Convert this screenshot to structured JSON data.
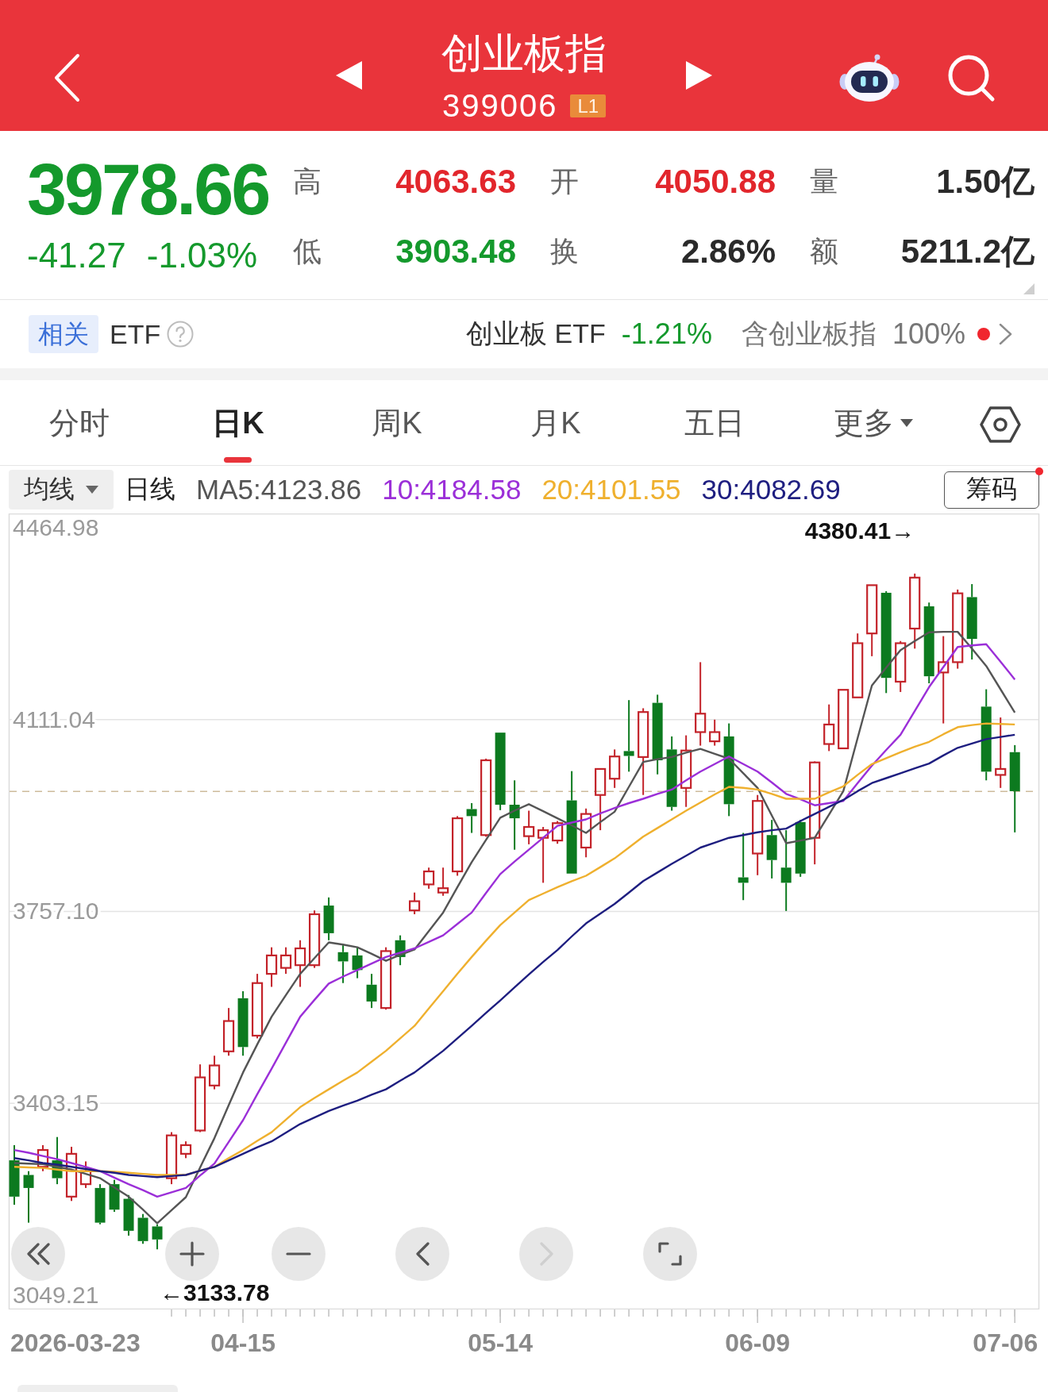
{
  "header": {
    "title": "创业板指",
    "code": "399006",
    "badge": "L1"
  },
  "quote": {
    "price": "3978.66",
    "change": "-41.27",
    "change_percent": "-1.03%",
    "falling": true
  },
  "stats": [
    {
      "label": "高",
      "value": "4063.63",
      "color": "#e2262c"
    },
    {
      "label": "开",
      "value": "4050.88",
      "color": "#e2262c"
    },
    {
      "label": "量",
      "value": "1.50亿",
      "color": "#2a2a2a"
    },
    {
      "label": "低",
      "value": "3903.48",
      "color": "#14992c"
    },
    {
      "label": "换",
      "value": "2.86%",
      "color": "#2a2a2a"
    },
    {
      "label": "额",
      "value": "5211.2亿",
      "color": "#2a2a2a"
    }
  ],
  "related": {
    "tag": "相关",
    "label": "ETF",
    "etf_name": "创业板 ETF",
    "etf_change": "-1.21%",
    "etf_falling": true,
    "holding_label": "含创业板指",
    "holding_percent": "100%",
    "alert": true
  },
  "tabs": [
    {
      "label": "分时",
      "kind": "tab",
      "selected": false
    },
    {
      "label": "日K",
      "kind": "tab",
      "selected": true
    },
    {
      "label": "周K",
      "kind": "tab",
      "selected": false
    },
    {
      "label": "月K",
      "kind": "tab",
      "selected": false
    },
    {
      "label": "五日",
      "kind": "tab",
      "selected": false
    },
    {
      "label": "更多",
      "kind": "menu",
      "selected": false
    }
  ],
  "indicator_bar": {
    "dropdown": "均线",
    "period": "日线",
    "ma": [
      {
        "label": "MA5:4123.86",
        "color": "#555555"
      },
      {
        "label": "10:4184.58",
        "color": "#9b2fd8"
      },
      {
        "label": "20:4101.55",
        "color": "#efb02e"
      },
      {
        "label": "30:4082.69",
        "color": "#1e1e80"
      }
    ],
    "chips_button": "筹码",
    "chips_alert": true
  },
  "chart": {
    "chart_data": {
      "type": "candlestick",
      "categories": [
        null,
        null,
        null,
        null,
        null,
        null,
        null,
        null,
        null,
        null,
        null,
        null,
        null,
        null,
        null,
        null,
        "04-15",
        null,
        null,
        null,
        null,
        null,
        null,
        null,
        null,
        null,
        null,
        null,
        null,
        null,
        null,
        null,
        null,
        null,
        "05-14",
        null,
        null,
        null,
        null,
        null,
        null,
        null,
        null,
        null,
        null,
        null,
        null,
        null,
        null,
        null,
        null,
        null,
        "06-09",
        null,
        null,
        null,
        null,
        null,
        null,
        null,
        null,
        null,
        null,
        null,
        null,
        null,
        null,
        null,
        null,
        null,
        null
      ],
      "ohlc": [
        [
          3298,
          3326,
          3216,
          3231
        ],
        [
          3271,
          3278,
          3183,
          3247
        ],
        [
          3286,
          3326,
          3278,
          3317
        ],
        [
          3298,
          3341,
          3254,
          3265
        ],
        [
          3231,
          3323,
          3223,
          3310
        ],
        [
          3254,
          3296,
          3247,
          3278
        ],
        [
          3247,
          3254,
          3180,
          3183
        ],
        [
          3254,
          3262,
          3203,
          3207
        ],
        [
          3227,
          3234,
          3159,
          3168
        ],
        [
          3192,
          3199,
          3144,
          3149
        ],
        [
          3176,
          3180,
          3133.78,
          3152
        ],
        [
          3265,
          3350,
          3254,
          3344
        ],
        [
          3310,
          3333,
          3302,
          3326
        ],
        [
          3353,
          3475,
          3350,
          3451
        ],
        [
          3436,
          3491,
          3429,
          3473
        ],
        [
          3499,
          3579,
          3491,
          3555
        ],
        [
          3597,
          3610,
          3491,
          3507
        ],
        [
          3528,
          3642,
          3523,
          3625
        ],
        [
          3642,
          3691,
          3618,
          3676
        ],
        [
          3653,
          3691,
          3642,
          3676
        ],
        [
          3658,
          3704,
          3618,
          3689
        ],
        [
          3658,
          3759,
          3653,
          3752
        ],
        [
          3768,
          3783,
          3704,
          3717
        ],
        [
          3682,
          3697,
          3625,
          3665
        ],
        [
          3676,
          3691,
          3634,
          3649
        ],
        [
          3622,
          3642,
          3579,
          3591
        ],
        [
          3579,
          3691,
          3576,
          3684
        ],
        [
          3704,
          3713,
          3658,
          3673
        ],
        [
          3759,
          3792,
          3752,
          3776
        ],
        [
          3807,
          3838,
          3799,
          3831
        ],
        [
          3792,
          3838,
          3786,
          3800
        ],
        [
          3831,
          3933,
          3823,
          3929
        ],
        [
          3946,
          3957,
          3902,
          3933
        ],
        [
          3898,
          4039,
          3895,
          4036
        ],
        [
          4087,
          4087,
          3944,
          3954
        ],
        [
          3954,
          3999,
          3871,
          3929
        ],
        [
          3896,
          3943,
          3881,
          3913
        ],
        [
          3893,
          3913,
          3810,
          3907
        ],
        [
          3888,
          3924,
          3882,
          3920
        ],
        [
          3962,
          4016,
          3827,
          3827
        ],
        [
          3875,
          3947,
          3857,
          3937
        ],
        [
          3972,
          4020,
          3907,
          4020
        ],
        [
          4002,
          4056,
          3985,
          4043
        ],
        [
          4053,
          4147,
          4015,
          4044
        ],
        [
          4042,
          4132,
          3972,
          4125
        ],
        [
          4142,
          4157,
          4010,
          4036
        ],
        [
          4056,
          4080,
          3943,
          3950
        ],
        [
          3985,
          4082,
          3950,
          4054
        ],
        [
          4088,
          4217,
          4063,
          4122
        ],
        [
          4071,
          4111,
          4063,
          4088
        ],
        [
          4080,
          4104,
          3933,
          3955
        ],
        [
          3820,
          3902,
          3778,
          3810
        ],
        [
          3864,
          3972,
          3824,
          3961
        ],
        [
          3898,
          3926,
          3818,
          3852
        ],
        [
          3838,
          3907,
          3758,
          3810
        ],
        [
          3922,
          3926,
          3821,
          3827
        ],
        [
          3893,
          4034,
          3844,
          4032
        ],
        [
          4066,
          4139,
          4053,
          4102
        ],
        [
          4058,
          4166,
          4058,
          4166
        ],
        [
          4152,
          4270,
          4152,
          4252
        ],
        [
          4270,
          4359,
          4228,
          4359
        ],
        [
          4345,
          4348,
          4160,
          4188
        ],
        [
          4181,
          4256,
          4162,
          4252
        ],
        [
          4279,
          4380.41,
          4242,
          4373
        ],
        [
          4320,
          4327,
          4178,
          4191
        ],
        [
          4198,
          4265,
          4104,
          4217
        ],
        [
          4217,
          4351,
          4205,
          4344
        ],
        [
          4337,
          4361,
          4222,
          4260
        ],
        [
          4135,
          4167,
          3999,
          4015
        ],
        [
          4009,
          4115,
          3985,
          4020
        ],
        [
          4051,
          4064,
          3903,
          3979
        ]
      ],
      "series": [
        {
          "type": "line",
          "color": "#555555",
          "values": [
            3293,
            3292,
            3291,
            3286,
            3281,
            3273,
            3265,
            3248,
            3231,
            3207,
            3182,
            3206,
            3230,
            3285,
            3339,
            3400,
            3460,
            3512,
            3563,
            3603,
            3642,
            3671,
            3700,
            3696,
            3691,
            3679,
            3666,
            3677,
            3687,
            3721,
            3755,
            3802,
            3848,
            3889,
            3930,
            3943,
            3955,
            3942,
            3929,
            3916,
            3902,
            3922,
            3941,
            3987,
            4033,
            4038,
            4042,
            4050,
            4057,
            4048,
            4039,
            4012,
            3985,
            3934,
            3883,
            3888,
            3893,
            3936,
            3979,
            4077,
            4174,
            4207,
            4239,
            4256,
            4272,
            4273,
            4273,
            4242,
            4210,
            4167,
            4124
          ]
        },
        {
          "type": "line",
          "color": "#9b2fd8",
          "values": [
            3317,
            3312,
            3306,
            3300,
            3293,
            3286,
            3278,
            3266,
            3254,
            3243,
            3231,
            3239,
            3247,
            3270,
            3292,
            3332,
            3372,
            3420,
            3467,
            3515,
            3563,
            3594,
            3624,
            3637,
            3649,
            3661,
            3673,
            3681,
            3689,
            3701,
            3713,
            3734,
            3755,
            3791,
            3826,
            3849,
            3871,
            3893,
            3915,
            3921,
            3927,
            3938,
            3948,
            3957,
            3965,
            3974,
            3982,
            3999,
            4015,
            4029,
            4043,
            4029,
            4015,
            3995,
            3974,
            3964,
            3953,
            3957,
            3961,
            3994,
            4026,
            4055,
            4083,
            4127,
            4171,
            4208,
            4245,
            4248,
            4250,
            4218,
            4185
          ]
        },
        {
          "type": "line",
          "color": "#efb02e",
          "values": [
            3286,
            3285,
            3284,
            3281,
            3278,
            3278,
            3278,
            3277,
            3275,
            3273,
            3271,
            3271,
            3271,
            3279,
            3286,
            3302,
            3317,
            3334,
            3350,
            3373,
            3396,
            3413,
            3429,
            3445,
            3460,
            3480,
            3500,
            3523,
            3546,
            3578,
            3610,
            3642,
            3673,
            3703,
            3732,
            3755,
            3778,
            3790,
            3802,
            3813,
            3823,
            3839,
            3855,
            3875,
            3895,
            3911,
            3927,
            3943,
            3958,
            3973,
            3987,
            3985,
            3982,
            3974,
            3965,
            3965,
            3965,
            3977,
            3988,
            4009,
            4029,
            4040,
            4051,
            4061,
            4070,
            4084,
            4097,
            4101,
            4104,
            4103,
            4102
          ]
        },
        {
          "type": "line",
          "color": "#1e1e80",
          "values": [
            3302,
            3298,
            3293,
            3290,
            3286,
            3282,
            3278,
            3275,
            3271,
            3269,
            3267,
            3269,
            3271,
            3279,
            3286,
            3298,
            3310,
            3322,
            3333,
            3349,
            3365,
            3377,
            3389,
            3399,
            3408,
            3419,
            3429,
            3445,
            3460,
            3480,
            3500,
            3523,
            3546,
            3570,
            3593,
            3617,
            3641,
            3664,
            3686,
            3711,
            3735,
            3753,
            3771,
            3792,
            3813,
            3829,
            3845,
            3860,
            3875,
            3884,
            3893,
            3898,
            3903,
            3907,
            3910,
            3924,
            3937,
            3950,
            3963,
            3979,
            3994,
            4003,
            4012,
            4021,
            4030,
            4045,
            4059,
            4067,
            4075,
            4079,
            4083
          ]
        }
      ],
      "ylim": [
        3022.86,
        4491.33
      ],
      "yticks": [
        {
          "value": 4464.98,
          "label": "4464.98"
        },
        {
          "value": 4111.04,
          "label": "4111.04"
        },
        {
          "value": 3757.1,
          "label": "3757.10"
        },
        {
          "value": 3403.15,
          "label": "3403.15"
        },
        {
          "value": 3049.21,
          "label": "3049.21"
        }
      ],
      "grid": true,
      "ref_lines": [
        {
          "axis": "y",
          "value": 3978.66
        }
      ],
      "annotations": [
        "4380.41→",
        "←3133.78"
      ]
    },
    "axis_start_label": "2026-03-23",
    "axis_end_label": "07-06",
    "controls": [
      {
        "kind": "rewind",
        "disabled": false
      },
      {
        "kind": "zoom_in",
        "disabled": false
      },
      {
        "kind": "zoom_out",
        "disabled": false
      },
      {
        "kind": "previous",
        "disabled": false
      },
      {
        "kind": "next",
        "disabled": true
      },
      {
        "kind": "fullscreen",
        "disabled": false
      }
    ]
  }
}
